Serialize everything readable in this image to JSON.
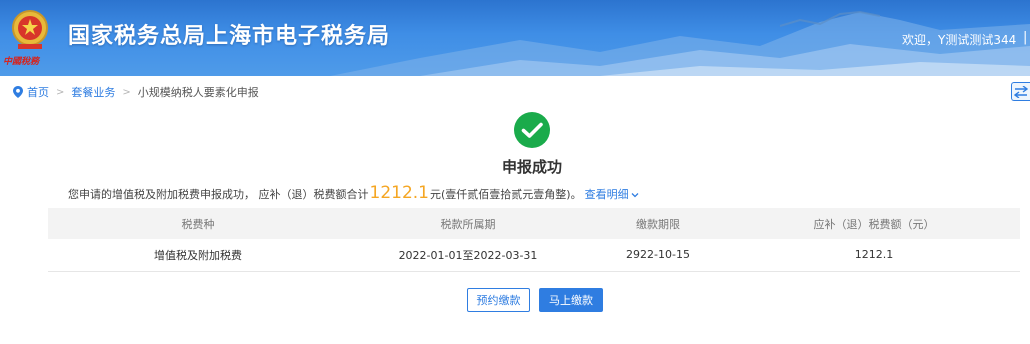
{
  "header": {
    "site_title": "国家税务总局上海市电子税务局",
    "sub_logo": "中國稅務",
    "welcome": "欢迎，Y测试测试344",
    "separator": "|"
  },
  "breadcrumb": {
    "home": "首页",
    "sep1": ">",
    "level2": "套餐业务",
    "sep2": ">",
    "current": "小规模纳税人要素化申报"
  },
  "result": {
    "title": "申报成功",
    "summary_prefix": "您申请的增值税及附加税费申报成功， 应补（退）税费额合计",
    "amount": "1212.1",
    "summary_suffix": "元(壹仟贰佰壹拾贰元壹角整)。",
    "detail_link": "查看明细"
  },
  "table": {
    "headers": [
      "税费种",
      "税款所属期",
      "缴款期限",
      "应补（退）税费额（元）"
    ],
    "rows": [
      [
        "增值税及附加税费",
        "2022-01-01至2022-03-31",
        "2922-10-15",
        "1212.1"
      ]
    ]
  },
  "actions": {
    "schedule_label": "预约缴款",
    "pay_now_label": "马上缴款"
  },
  "colors": {
    "header_blue": "#3f8ee6",
    "link_blue": "#2f7de1",
    "success_green": "#1aab4b",
    "amount_orange": "#f5a623"
  },
  "icons": {
    "emblem": "national-emblem-icon",
    "breadcrumb": "location-pin-icon",
    "success": "check-circle-icon",
    "back": "back-arrow-icon",
    "detail": "chevron-down-icon"
  }
}
